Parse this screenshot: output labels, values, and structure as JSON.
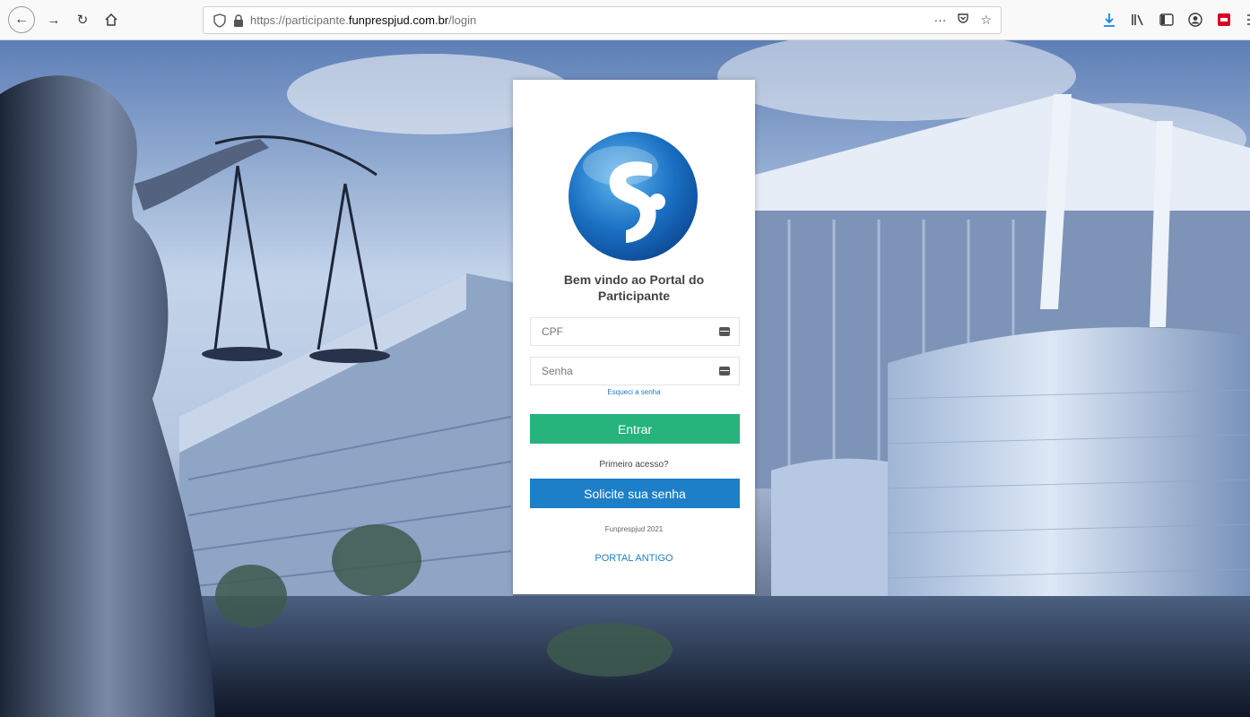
{
  "browser": {
    "url_prefix": "https://participante.",
    "url_domain": "funprespjud.com.br",
    "url_path": "/login",
    "more_icon": "ellipsis-icon",
    "pocket_icon": "pocket-icon",
    "bookmark_icon": "star-icon"
  },
  "login": {
    "welcome": "Bem vindo ao Portal do Participante",
    "cpf_placeholder": "CPF",
    "password_placeholder": "Senha",
    "forgot_password": "Esqueci a senha",
    "enter_button": "Entrar",
    "first_access": "Primeiro acesso?",
    "request_button": "Solicite sua senha",
    "copyright": "Funprespjud 2021",
    "old_portal": "PORTAL ANTIGO"
  },
  "colors": {
    "enter_button": "#26b37c",
    "request_button": "#1d7fc7",
    "link": "#1f78c8"
  }
}
